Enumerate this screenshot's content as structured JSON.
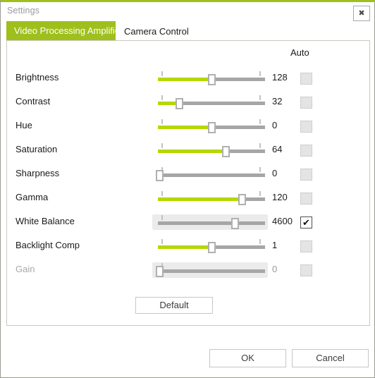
{
  "window": {
    "title": "Settings",
    "close_label": "✖",
    "accent_color": "#9fbf1c"
  },
  "tabs": [
    {
      "label": "Video Processing Amplifier",
      "active": true
    },
    {
      "label": "Camera Control",
      "active": false
    }
  ],
  "panel": {
    "auto_header": "Auto",
    "slider_green": "#b4d800",
    "rows": [
      {
        "label": "Brightness",
        "value": "128",
        "fill_pct": 50,
        "thumb_pct": 50,
        "auto": false,
        "checked": false,
        "disabled": false,
        "highlight": false
      },
      {
        "label": "Contrast",
        "value": "32",
        "fill_pct": 20,
        "thumb_pct": 20,
        "auto": false,
        "checked": false,
        "disabled": false,
        "highlight": false
      },
      {
        "label": "Hue",
        "value": "0",
        "fill_pct": 50,
        "thumb_pct": 50,
        "auto": false,
        "checked": false,
        "disabled": false,
        "highlight": false
      },
      {
        "label": "Saturation",
        "value": "64",
        "fill_pct": 63,
        "thumb_pct": 63,
        "auto": false,
        "checked": false,
        "disabled": false,
        "highlight": false
      },
      {
        "label": "Sharpness",
        "value": "0",
        "fill_pct": 0,
        "thumb_pct": 1,
        "auto": false,
        "checked": false,
        "disabled": false,
        "highlight": false
      },
      {
        "label": "Gamma",
        "value": "120",
        "fill_pct": 78,
        "thumb_pct": 78,
        "auto": false,
        "checked": false,
        "disabled": false,
        "highlight": false
      },
      {
        "label": "White Balance",
        "value": "4600",
        "fill_pct": 0,
        "thumb_pct": 72,
        "auto": true,
        "checked": true,
        "disabled": false,
        "highlight": true
      },
      {
        "label": "Backlight Comp",
        "value": "1",
        "fill_pct": 50,
        "thumb_pct": 50,
        "auto": false,
        "checked": false,
        "disabled": false,
        "highlight": false
      },
      {
        "label": "Gain",
        "value": "0",
        "fill_pct": 0,
        "thumb_pct": 1,
        "auto": false,
        "checked": false,
        "disabled": true,
        "highlight": true
      }
    ],
    "default_button": "Default"
  },
  "footer": {
    "ok_label": "OK",
    "cancel_label": "Cancel"
  }
}
